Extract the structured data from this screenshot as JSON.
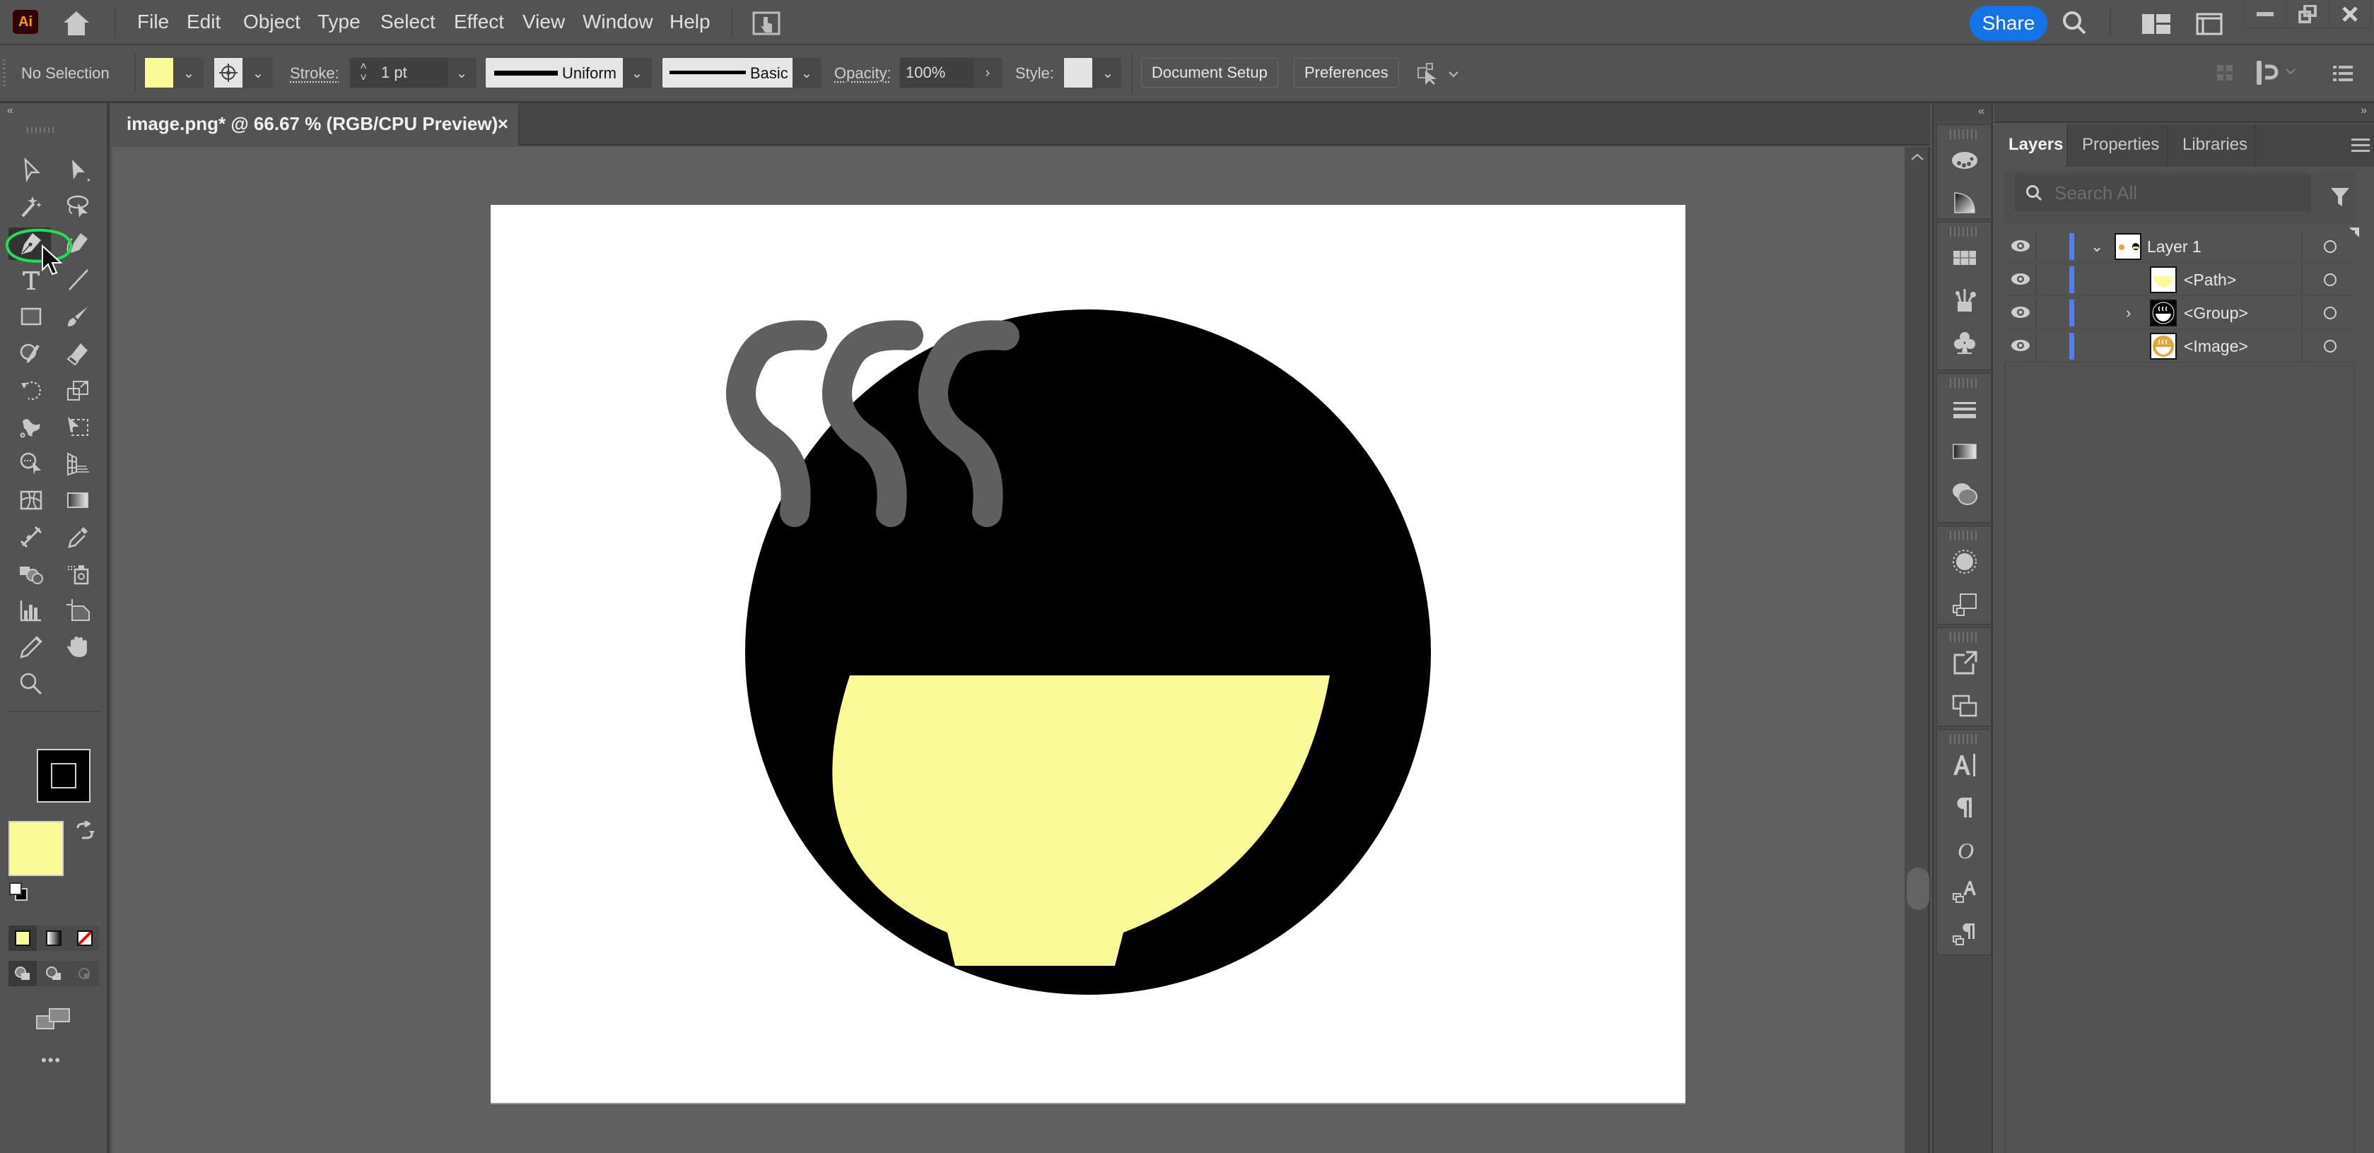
{
  "app": {
    "logo_text": "Ai",
    "menu": [
      "File",
      "Edit",
      "Object",
      "Type",
      "Select",
      "Effect",
      "View",
      "Window",
      "Help"
    ],
    "share_label": "Share",
    "colors": {
      "share": "#1473e6",
      "fill": "#fafb97",
      "artboard": "#ffffff",
      "canvas": "#606060",
      "layer_color": "#4f7dff"
    }
  },
  "control_bar": {
    "selection_status": "No Selection",
    "stroke_label": "Stroke:",
    "stroke_weight": "1 pt",
    "stroke_profile": "Uniform",
    "brush_definition": "Basic",
    "opacity_label": "Opacity:",
    "opacity_value": "100%",
    "style_label": "Style:",
    "document_setup_label": "Document Setup",
    "preferences_label": "Preferences"
  },
  "document": {
    "tab_title": "image.png* @ 66.67 % (RGB/CPU Preview)",
    "close_glyph": "×",
    "zoom": "66.67 %",
    "color_mode": "RGB/CPU Preview"
  },
  "toolbar": {
    "active_tool": "pen-tool",
    "tools": [
      [
        "selection-tool",
        "direct-selection-tool"
      ],
      [
        "magic-wand-tool",
        "lasso-tool"
      ],
      [
        "pen-tool",
        "curvature-tool"
      ],
      [
        "type-tool",
        "line-segment-tool"
      ],
      [
        "rectangle-tool",
        "paintbrush-tool"
      ],
      [
        "shaper-tool",
        "eraser-tool"
      ],
      [
        "rotate-tool",
        "scale-tool"
      ],
      [
        "puppet-warp-tool",
        "free-transform-tool"
      ],
      [
        "shape-builder-tool",
        "perspective-grid-tool"
      ],
      [
        "mesh-tool",
        "gradient-tool"
      ],
      [
        "blend-tool",
        "eyedropper-tool"
      ],
      [
        "symbol-sprayer-tool",
        "live-paint-bucket-tool"
      ],
      [
        "column-graph-tool",
        "artboard-tool"
      ],
      [
        "knife-tool",
        "hand-tool"
      ],
      [
        "zoom-tool"
      ]
    ],
    "fill_color": "#fafb97",
    "stroke_color": "#000000",
    "more_glyph": "•••"
  },
  "artwork": {
    "circle_color": "#000000",
    "steam_color": "#5f5f5f",
    "bowl_color": "#fafb97",
    "steam_count": 3
  },
  "right_panel": {
    "tabs": [
      "Layers",
      "Properties",
      "Libraries"
    ],
    "active_tab": "Layers",
    "search_placeholder": "Search All",
    "layers": [
      {
        "name": "Layer 1",
        "level": 0,
        "expanded": true,
        "visible": true
      },
      {
        "name": "<Path>",
        "level": 1,
        "visible": true
      },
      {
        "name": "<Group>",
        "level": 1,
        "collapsed": true,
        "visible": true
      },
      {
        "name": "<Image>",
        "level": 1,
        "visible": true
      }
    ]
  },
  "icon_strip": [
    [
      "color-icon",
      "color-guide-icon"
    ],
    [
      "swatches-icon",
      "brushes-icon",
      "symbols-icon"
    ],
    [
      "stroke-icon",
      "gradient-icon",
      "transparency-icon"
    ],
    [
      "appearance-icon",
      "graphic-styles-icon"
    ],
    [
      "asset-export-icon",
      "artboards-icon"
    ],
    [
      "character-icon",
      "paragraph-icon",
      "opentype-icon",
      "character-styles-icon",
      "paragraph-styles-icon"
    ]
  ]
}
